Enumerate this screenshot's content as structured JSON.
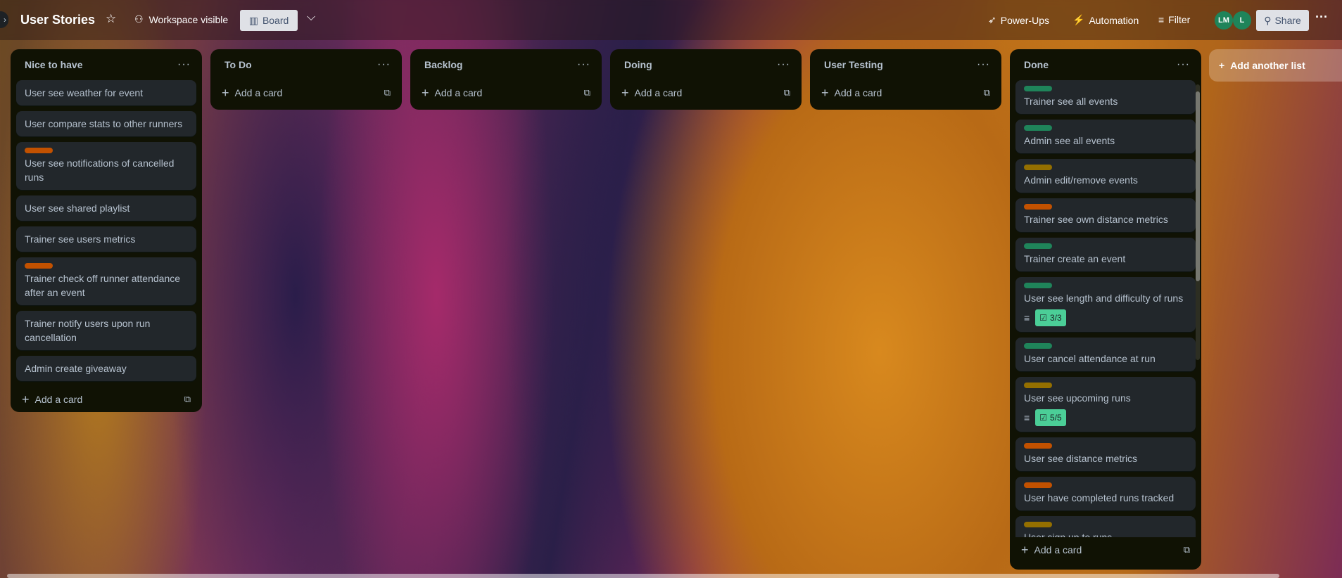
{
  "header": {
    "board_title": "User Stories",
    "visibility": "Workspace visible",
    "view": "Board",
    "power_ups": "Power-Ups",
    "automation": "Automation",
    "filter": "Filter",
    "avatars": [
      "LM",
      "L"
    ],
    "share": "Share"
  },
  "lists": {
    "nice": {
      "title": "Nice to have",
      "cards": [
        {
          "text": "User see weather for event"
        },
        {
          "text": "User compare stats to other runners"
        },
        {
          "text": "User see notifications of cancelled runs",
          "label": "orange"
        },
        {
          "text": "User see shared playlist"
        },
        {
          "text": "Trainer see users metrics"
        },
        {
          "text": "Trainer check off runner attendance after an event",
          "label": "orange"
        },
        {
          "text": "Trainer notify users upon run cancellation"
        },
        {
          "text": "Admin create giveaway"
        }
      ]
    },
    "todo": {
      "title": "To Do"
    },
    "backlog": {
      "title": "Backlog"
    },
    "doing": {
      "title": "Doing"
    },
    "testing": {
      "title": "User Testing"
    },
    "done": {
      "title": "Done",
      "cards": [
        {
          "text": "Trainer see all events",
          "label": "green"
        },
        {
          "text": "Admin see all events",
          "label": "green"
        },
        {
          "text": "Admin edit/remove events",
          "label": "yellow"
        },
        {
          "text": "Trainer see own distance metrics",
          "label": "orange"
        },
        {
          "text": "Trainer create an event",
          "label": "green"
        },
        {
          "text": "User see length and difficulty of runs",
          "label": "green",
          "checklist": "3/3"
        },
        {
          "text": "User cancel attendance at run",
          "label": "green"
        },
        {
          "text": "User see upcoming runs",
          "label": "yellow",
          "checklist": "5/5"
        },
        {
          "text": "User see distance metrics",
          "label": "orange"
        },
        {
          "text": "User have completed runs tracked",
          "label": "orange"
        },
        {
          "text": "User sign up to runs",
          "label": "yellow"
        }
      ]
    }
  },
  "add_card": "Add a card",
  "add_list": "Add another list",
  "label_colors": {
    "green": "#1f845a",
    "orange": "#c25100",
    "yellow": "#946f00"
  }
}
